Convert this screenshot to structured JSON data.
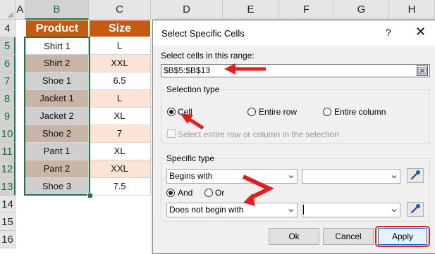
{
  "columns": [
    "A",
    "B",
    "C",
    "D",
    "E",
    "F",
    "G",
    "H"
  ],
  "rows": [
    "4",
    "5",
    "6",
    "7",
    "8",
    "9",
    "10",
    "11",
    "12",
    "13",
    "14",
    "15",
    "16"
  ],
  "table": {
    "headers": [
      "Product",
      "Size"
    ],
    "products": [
      "Shirt 1",
      "Shirt 2",
      "Shoe 1",
      "Jacket 1",
      "Jacket 2",
      "Shoe 2",
      "Pant 1",
      "Pant 2",
      "Shoe 3"
    ],
    "sizes": [
      "L",
      "XXL",
      "6.5",
      "L",
      "XL",
      "7",
      "XL",
      "XXL",
      "7.5"
    ]
  },
  "dialog": {
    "title": "Select Specific Cells",
    "help": "?",
    "close": "✕",
    "range_label": "Select cells in this range:",
    "range_value": "$B$5:$B$13",
    "selection_type_label": "Selection type",
    "option_cell": "Cell",
    "option_entire_row": "Entire row",
    "option_entire_column": "Entire column",
    "select_entire_label": "Select entire row or column in the selection",
    "specific_type_label": "Specific type",
    "criteria1_value": "Begins with",
    "criteria1_text": "",
    "and_label": "And",
    "or_label": "Or",
    "criteria2_value": "Does not begin with",
    "criteria2_text": "",
    "ok_label": "Ok",
    "cancel_label": "Cancel",
    "apply_label": "Apply"
  },
  "colors": {
    "header_fill": "#c55a11",
    "annotation_red": "#e02020",
    "selection_green": "#217346"
  }
}
